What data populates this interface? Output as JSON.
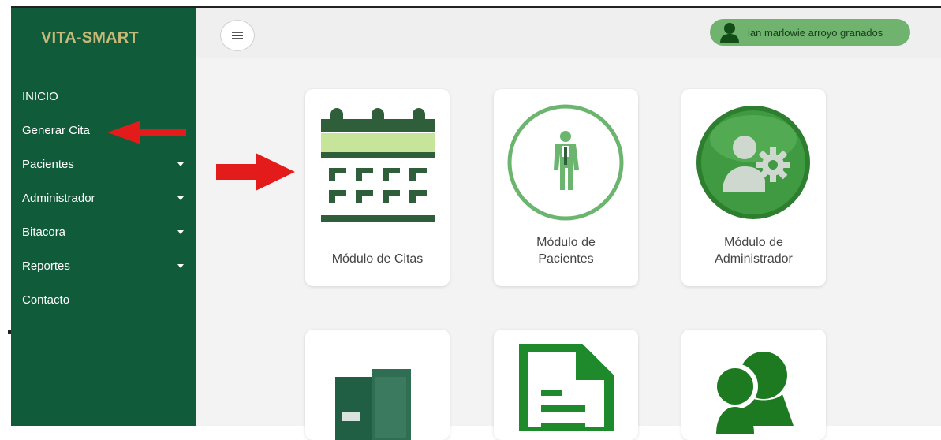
{
  "sidebar": {
    "brand": "VITA-SMART",
    "items": [
      {
        "label": "INICIO",
        "caret": false
      },
      {
        "label": "Generar Cita",
        "caret": false
      },
      {
        "label": "Pacientes",
        "caret": true
      },
      {
        "label": "Administrador",
        "caret": true
      },
      {
        "label": "Bitacora",
        "caret": true
      },
      {
        "label": "Reportes",
        "caret": true
      },
      {
        "label": "Contacto",
        "caret": false
      }
    ]
  },
  "header": {
    "menu_icon": "hamburger-icon",
    "user_name": "ian marlowie arroyo granados",
    "user_icon": "user-icon"
  },
  "cards": [
    {
      "label": "Módulo de Citas",
      "icon": "calendar-icon"
    },
    {
      "label": "Módulo de Pacientes",
      "icon": "patient-icon"
    },
    {
      "label": "Módulo de Administrador",
      "icon": "admin-gear-icon"
    },
    {
      "label": "",
      "icon": "archive-icon"
    },
    {
      "label": "",
      "icon": "document-icon"
    },
    {
      "label": "",
      "icon": "users-icon"
    }
  ],
  "colors": {
    "sidebar": "#105b39",
    "brand": "#c7b979",
    "accent_green": "#2e7d32",
    "pill": "#6fb36f",
    "annotation_arrow": "#e31b1b"
  }
}
